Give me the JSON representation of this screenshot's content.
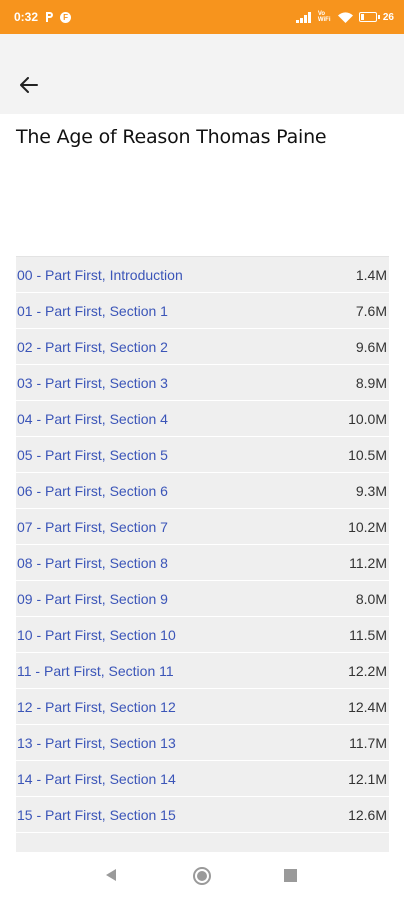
{
  "status_bar": {
    "time": "0:32",
    "battery_percent": "26",
    "battery_level": 0.26,
    "network_label": "Vo WiFi"
  },
  "icons": {
    "back": "arrow-left-icon",
    "status_p": "p-icon",
    "status_app": "app-notification-icon",
    "signal": "signal-icon",
    "wifi": "wifi-icon",
    "battery": "battery-icon",
    "nav_back": "triangle-back-icon",
    "nav_home": "circle-home-icon",
    "nav_recents": "square-recents-icon"
  },
  "header": {
    "title": "The Age of Reason Thomas Paine"
  },
  "files": [
    {
      "name": "00 - Part First, Introduction",
      "size": "1.4M"
    },
    {
      "name": "01 - Part First, Section 1",
      "size": "7.6M"
    },
    {
      "name": "02 - Part First, Section 2",
      "size": "9.6M"
    },
    {
      "name": "03 - Part First, Section 3",
      "size": "8.9M"
    },
    {
      "name": "04 - Part First, Section 4",
      "size": "10.0M"
    },
    {
      "name": "05 - Part First, Section 5",
      "size": "10.5M"
    },
    {
      "name": "06 - Part First, Section 6",
      "size": "9.3M"
    },
    {
      "name": "07 - Part First, Section 7",
      "size": "10.2M"
    },
    {
      "name": "08 - Part First, Section 8",
      "size": "11.2M"
    },
    {
      "name": "09 - Part First, Section 9",
      "size": "8.0M"
    },
    {
      "name": "10 - Part First, Section 10",
      "size": "11.5M"
    },
    {
      "name": "11 - Part First, Section 11",
      "size": "12.2M"
    },
    {
      "name": "12 - Part First, Section 12",
      "size": "12.4M"
    },
    {
      "name": "13 - Part First, Section 13",
      "size": "11.7M"
    },
    {
      "name": "14 - Part First, Section 14",
      "size": "12.1M"
    },
    {
      "name": "15 - Part First, Section 15",
      "size": "12.6M"
    }
  ],
  "colors": {
    "status_bar": "#f7941d",
    "link": "#3b55b8",
    "list_bg": "#efefef"
  }
}
